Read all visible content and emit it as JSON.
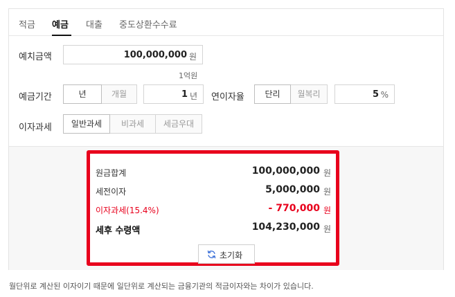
{
  "tabs": [
    "적금",
    "예금",
    "대출",
    "중도상환수수료"
  ],
  "active_tab": "예금",
  "deposit": {
    "label": "예치금액",
    "value": "100,000,000",
    "unit": "원",
    "hint": "1억원"
  },
  "period": {
    "label": "예금기간",
    "options": [
      "년",
      "개월"
    ],
    "selected": "년",
    "value": "1",
    "unit": "년"
  },
  "rate": {
    "label": "연이자율",
    "options": [
      "단리",
      "월복리"
    ],
    "selected": "단리",
    "value": "5",
    "unit": "%"
  },
  "tax": {
    "label": "이자과세",
    "options": [
      "일반과세",
      "비과세",
      "세금우대"
    ],
    "selected": "일반과세"
  },
  "result": {
    "rows": [
      {
        "label": "원금합계",
        "value": "100,000,000",
        "unit": "원"
      },
      {
        "label": "세전이자",
        "value": "5,000,000",
        "unit": "원"
      },
      {
        "label": "이자과세(15.4%)",
        "value": "- 770,000",
        "unit": "원"
      },
      {
        "label": "세후 수령액",
        "value": "104,230,000",
        "unit": "원"
      }
    ],
    "reset_label": "초기화"
  },
  "footnote": "월단위로 계산된 이자이기 때문에 일단위로 계산되는 금융기관의 적금이자와는 차이가 있습니다.",
  "colors": {
    "accent_red": "#e8001c",
    "text": "#333333",
    "border": "#d4d4d4"
  },
  "icons": {
    "reset": "refresh-icon"
  }
}
